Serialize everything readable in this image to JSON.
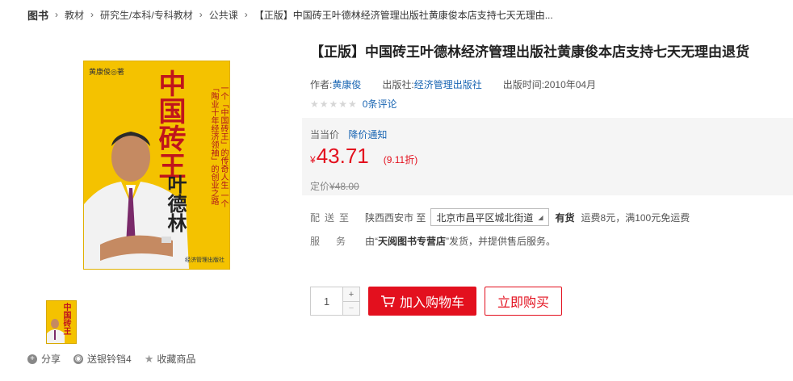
{
  "breadcrumb": {
    "items": [
      "图书",
      "教材",
      "研究生/本科/专科教材",
      "公共课",
      "【正版】中国砖王叶德林经济管理出版社黄康俊本店支持七天无理由..."
    ],
    "separator": "›"
  },
  "cover": {
    "author_small": "黄康俊◎著",
    "title_big": "中国砖王",
    "subtitle": "一个「中国砖王」的传奇人生 一个「陶业十年经济领袖」的创业之路",
    "name": "叶德林",
    "publisher_logo": "经济管理出版社",
    "thumb_title": "中国砖王"
  },
  "share_bar": {
    "share": "分享",
    "gift": "送银铃铛4",
    "favorite": "收藏商品"
  },
  "product": {
    "title": "【正版】中国砖王叶德林经济管理出版社黄康俊本店支持七天无理由退货",
    "author_label": "作者:",
    "author": "黄康俊",
    "publisher_label": "出版社:",
    "publisher": "经济管理出版社",
    "pubdate": "出版时间:2010年04月",
    "stars": "★★★★★",
    "reviews": "0条评论"
  },
  "price": {
    "label": "当当价",
    "notify": "降价通知",
    "currency": "¥",
    "value": "43.71",
    "discount": "(9.11折)",
    "list_label": "定价",
    "list_value": "¥48.00"
  },
  "shipping": {
    "label": "配送至",
    "origin": "陕西西安市 至",
    "address": "北京市昌平区城北街道",
    "stock": "有货",
    "fee": "运费8元，满100元免运费"
  },
  "service": {
    "label": "服务",
    "prefix": "由“",
    "shop": "天阅图书专营店",
    "suffix": "”发货，并提供售后服务。"
  },
  "purchase": {
    "quantity": "1",
    "plus": "+",
    "minus": "−",
    "add_to_cart": "加入购物车",
    "buy_now": "立即购买"
  },
  "colors": {
    "accent_red": "#e3101e",
    "link_blue": "#1a66b3",
    "cover_yellow": "#f4c200"
  }
}
